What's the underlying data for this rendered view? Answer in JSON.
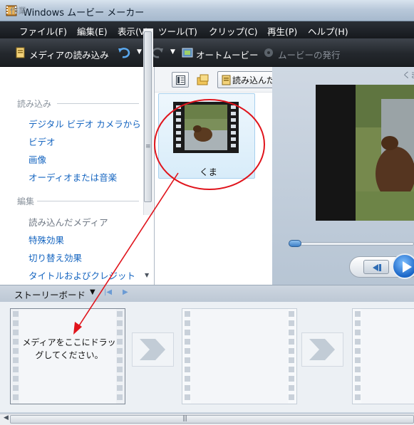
{
  "window": {
    "title": "Windows ムービー メーカー"
  },
  "menu": [
    {
      "label": "ファイル(F)"
    },
    {
      "label": "編集(E)"
    },
    {
      "label": "表示(V)"
    },
    {
      "label": "ツール(T)"
    },
    {
      "label": "クリップ(C)"
    },
    {
      "label": "再生(P)"
    },
    {
      "label": "ヘルプ(H)"
    }
  ],
  "toolbar": {
    "import_label": "メディアの読み込み",
    "automovie_label": "オートムービー",
    "publish_label": "ムービーの発行"
  },
  "taskpane": {
    "header": "作業",
    "import_section": "読み込み",
    "import_links": [
      "デジタル ビデオ カメラから",
      "ビデオ",
      "画像",
      "オーディオまたは音楽"
    ],
    "edit_section": "編集",
    "edit_links": [
      "読み込んだメディア",
      "特殊効果",
      "切り替え効果",
      "タイトルおよびクレジット"
    ]
  },
  "collection": {
    "imported_button": "読み込んだ",
    "clip_name": "くま"
  },
  "preview": {
    "title": "くま"
  },
  "storyboard": {
    "label": "ストーリーボード",
    "drop_hint": "メディアをここにドラッグしてください。"
  },
  "colors": {
    "link": "#1565c0",
    "annotation": "#e0141c"
  }
}
